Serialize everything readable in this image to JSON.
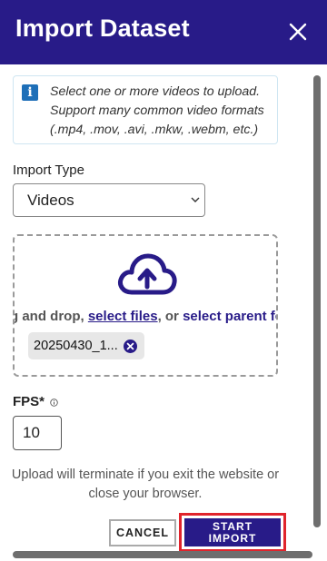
{
  "dialog": {
    "title": "Import Dataset"
  },
  "info": {
    "text": "Select one or more videos to upload. Support many common video formats (.mp4, .mov, .avi, .mkw, .webm, etc.)"
  },
  "import_type": {
    "label": "Import Type",
    "selected": "Videos"
  },
  "dropzone": {
    "prefix": "Drag and drop, ",
    "select_files": "select files",
    "middle": ", or ",
    "select_folder": "select parent folder",
    "files": [
      {
        "name": "20250430_1..."
      }
    ]
  },
  "fps": {
    "label": "FPS*",
    "value": "10"
  },
  "warning": "Upload will terminate if you exit the website or close your browser.",
  "actions": {
    "cancel": "CANCEL",
    "start_line1": "START",
    "start_line2": "IMPORT"
  },
  "colors": {
    "header_bg": "#281b88",
    "primary": "#281b88",
    "highlight": "#e0242c",
    "info_icon": "#1e6fb8"
  }
}
